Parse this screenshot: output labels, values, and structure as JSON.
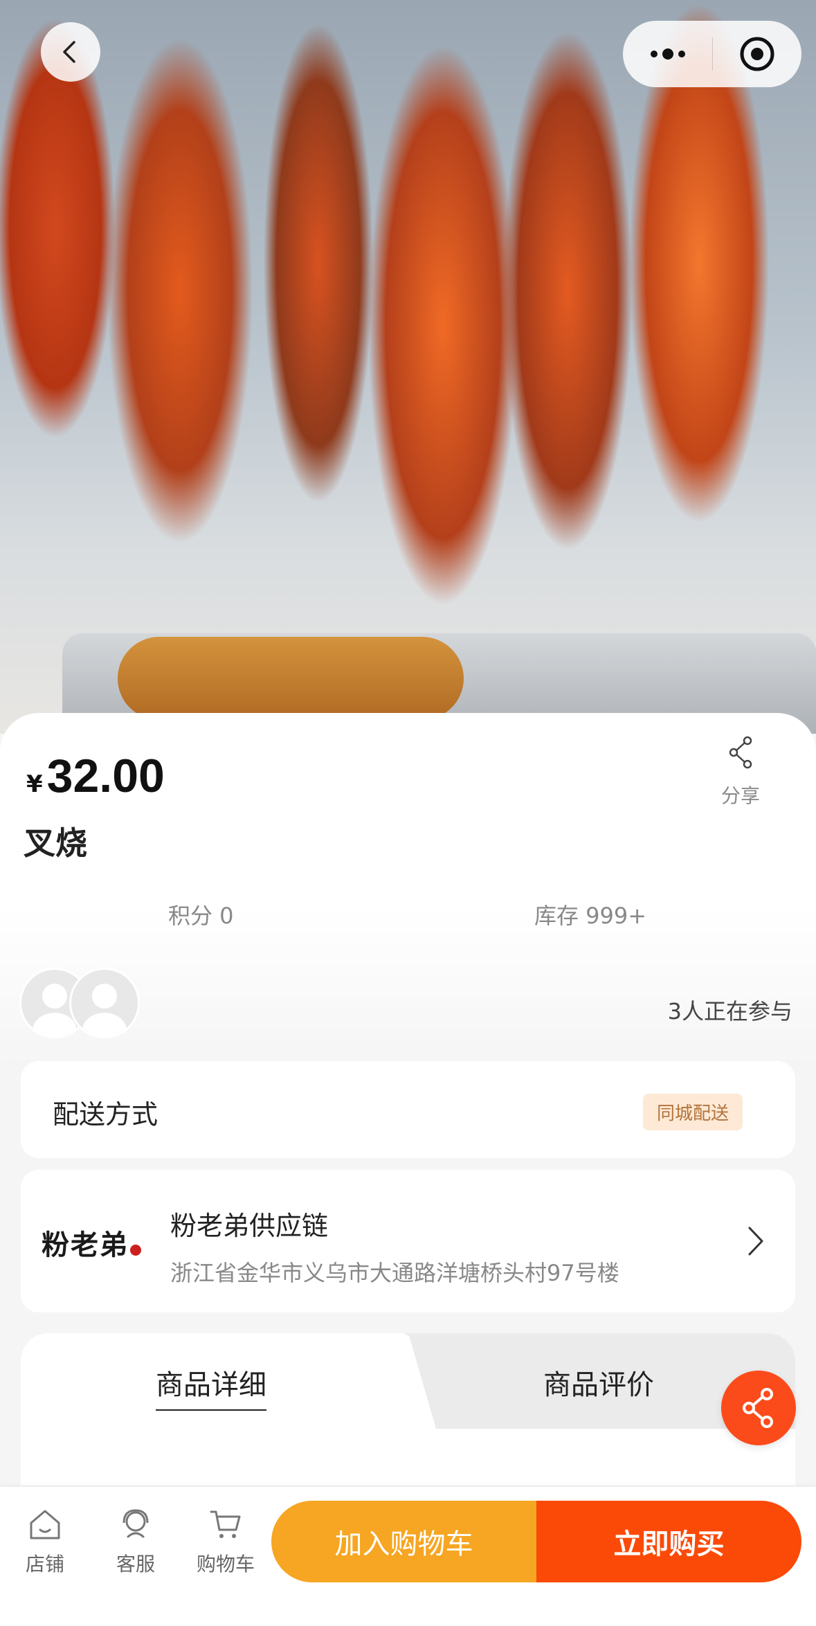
{
  "product": {
    "currency": "¥",
    "price": "32.00",
    "title": "叉烧",
    "share_label": "分享",
    "points": "积分 0",
    "stock": "库存 999+",
    "participants": "3人正在参与"
  },
  "delivery": {
    "label": "配送方式",
    "tag": "同城配送"
  },
  "store": {
    "logo_text": "粉老弟",
    "name": "粉老弟供应链",
    "address": "浙江省金华市义乌市大通路洋塘桥头村97号楼"
  },
  "tabs": [
    {
      "label": "商品详细",
      "active": true
    },
    {
      "label": "商品评价",
      "active": false
    }
  ],
  "bottom_nav": [
    {
      "label": "店铺",
      "icon": "home-icon"
    },
    {
      "label": "客服",
      "icon": "customer-service-icon"
    },
    {
      "label": "购物车",
      "icon": "cart-icon"
    }
  ],
  "actions": {
    "add_to_cart": "加入购物车",
    "buy_now": "立即购买"
  },
  "colors": {
    "accent_orange": "#fb4a08",
    "cart_yellow": "#f6a622",
    "tag_bg": "#fde9d6"
  }
}
